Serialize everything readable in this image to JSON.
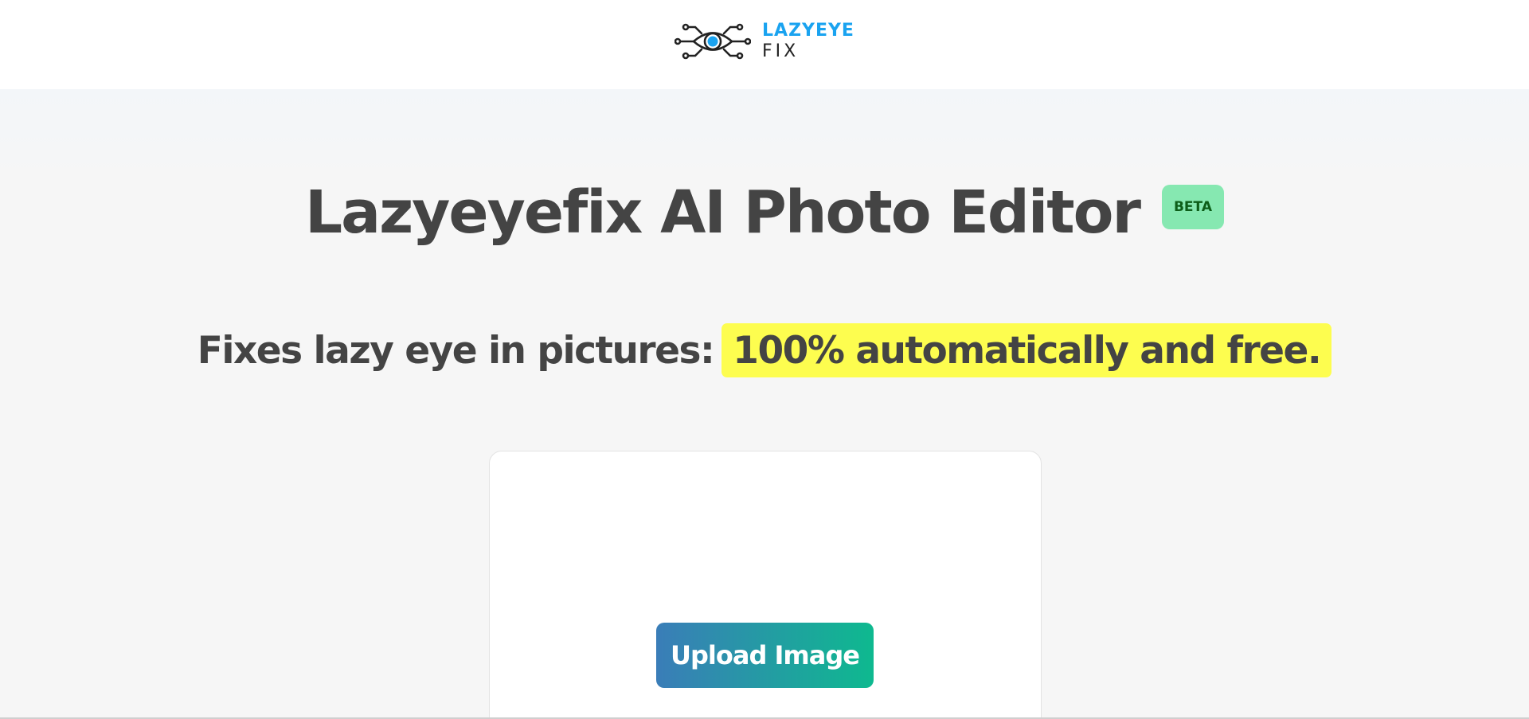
{
  "header": {
    "logo_line1": "LAZYEYE",
    "logo_line2": "FIX",
    "logo_icon": "eye-circuit-icon",
    "brand_color": "#1aa3f0"
  },
  "hero": {
    "title": "Lazyeyefix AI Photo Editor",
    "badge": "BETA",
    "subtitle_plain": "Fixes lazy eye in pictures:",
    "subtitle_highlight": "100% automatically and free.",
    "highlight_color": "#fdfd4f",
    "badge_color": "#86e8b1"
  },
  "upload": {
    "button_label": "Upload Image",
    "button_gradient": [
      "#3a7db8",
      "#0eb98f"
    ]
  }
}
